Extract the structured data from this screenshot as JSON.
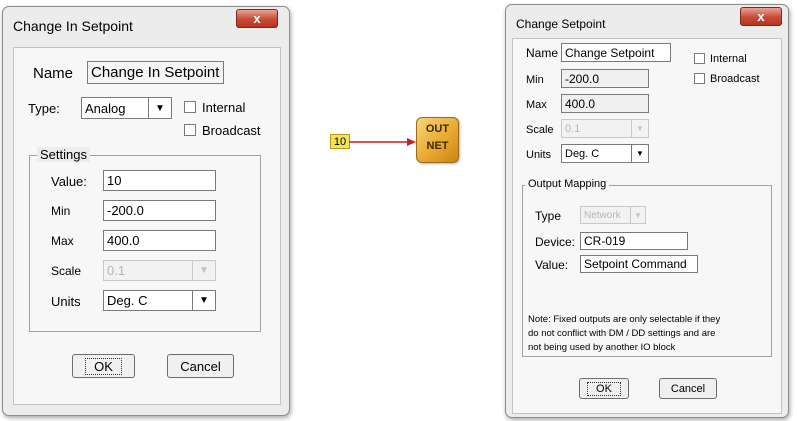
{
  "left_dialog": {
    "title": "Change In Setpoint",
    "close": "x",
    "name_label": "Name",
    "name_value": "Change In Setpoint",
    "type_label": "Type:",
    "type_value": "Analog",
    "internal_label": "Internal",
    "broadcast_label": "Broadcast",
    "settings_legend": "Settings",
    "value_label": "Value:",
    "value_value": "10",
    "min_label": "Min",
    "min_value": "-200.0",
    "max_label": "Max",
    "max_value": "400.0",
    "scale_label": "Scale",
    "scale_value": "0.1",
    "units_label": "Units",
    "units_value": "Deg. C",
    "ok_label": "OK",
    "cancel_label": "Cancel"
  },
  "diagram": {
    "input_value": "10",
    "block_line1": "OUT",
    "block_line2": "NET"
  },
  "right_dialog": {
    "title": "Change Setpoint",
    "close": "x",
    "name_label": "Name",
    "name_value": "Change Setpoint",
    "internal_label": "Internal",
    "broadcast_label": "Broadcast",
    "min_label": "Min",
    "min_value": "-200.0",
    "max_label": "Max",
    "max_value": "400.0",
    "scale_label": "Scale",
    "scale_value": "0.1",
    "units_label": "Units",
    "units_value": "Deg. C",
    "output_legend": "Output Mapping",
    "type_label": "Type",
    "type_value": "Network",
    "device_label": "Device:",
    "device_value": "CR-019",
    "value_label": "Value:",
    "value_value": "Setpoint Command",
    "note_line1": "Note: Fixed outputs are only selectable if they",
    "note_line2": "do not conflict with DM / DD settings and are",
    "note_line3": "not being used by another IO block",
    "ok_label": "OK",
    "cancel_label": "Cancel"
  },
  "colors": {
    "close_button": "#c84a36",
    "input_box": "#f2e45a",
    "arrow": "#cc1f1f",
    "block": "#e8a52a"
  },
  "icons": {
    "dropdown": "▼",
    "close": "x"
  }
}
